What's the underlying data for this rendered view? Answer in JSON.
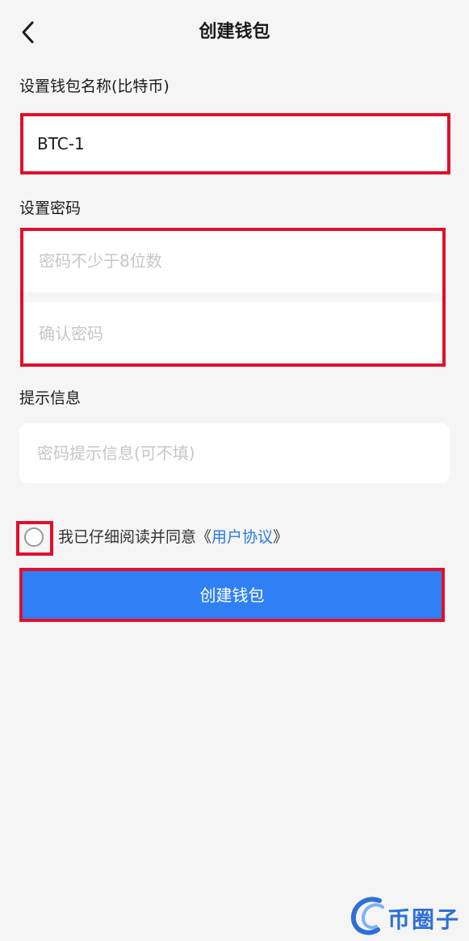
{
  "header": {
    "title": "创建钱包",
    "back_icon": "chevron-left-icon"
  },
  "wallet_name": {
    "label": "设置钱包名称(比特币)",
    "value": "BTC-1"
  },
  "password": {
    "label": "设置密码",
    "placeholder": "密码不少于8位数",
    "confirm_placeholder": "确认密码"
  },
  "hint": {
    "label": "提示信息",
    "placeholder": "密码提示信息(可不填)"
  },
  "agreement": {
    "prefix": "我已仔细阅读并同意",
    "open_quote": "《",
    "link_text": "用户协议",
    "close_quote": "》"
  },
  "create_button": {
    "label": "创建钱包"
  },
  "watermark": {
    "text": "币圈子"
  },
  "colors": {
    "accent": "#2f80f5",
    "link": "#2a78e4",
    "highlight": "#e0102a",
    "background": "#f5f5f5"
  }
}
